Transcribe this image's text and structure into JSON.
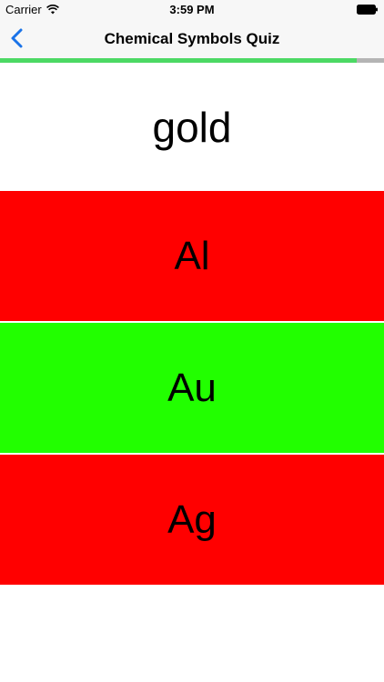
{
  "status_bar": {
    "carrier": "Carrier",
    "time": "3:59 PM"
  },
  "nav": {
    "title": "Chemical Symbols Quiz",
    "back_icon": "chevron-left-icon",
    "accent_color": "#1a73e8"
  },
  "progress": {
    "fraction": 0.93,
    "fill_color": "#4cd964",
    "track_color": "#b4b4b4"
  },
  "question": {
    "text": "gold"
  },
  "answers": [
    {
      "label": "Al",
      "color": "#ff0000"
    },
    {
      "label": "Au",
      "color": "#22ff00"
    },
    {
      "label": "Ag",
      "color": "#ff0000"
    }
  ]
}
